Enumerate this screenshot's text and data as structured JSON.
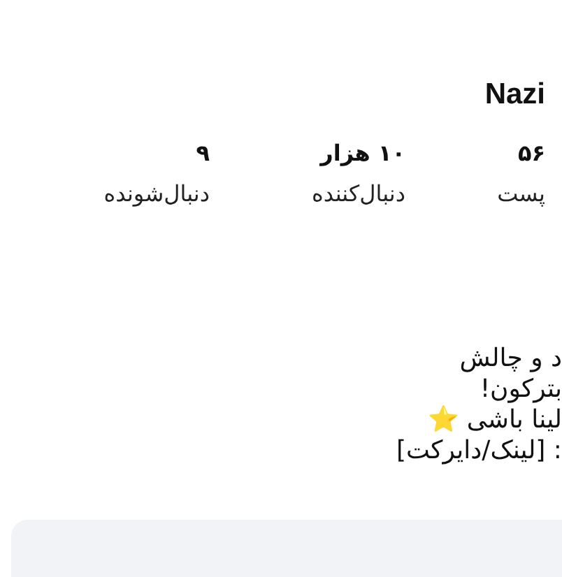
{
  "profile": {
    "name": "Nazi"
  },
  "stats": [
    {
      "value": "۵۶",
      "label": "پست"
    },
    {
      "value": "۱۰ هزار",
      "label": "دنبال‌کننده"
    },
    {
      "value": "۹",
      "label": "دنبال‌شونده"
    }
  ],
  "bio": [
    "د و چالش",
    "بترکون!",
    "لینا باشی ⭐",
    ": [لینک/دایرکت]"
  ]
}
